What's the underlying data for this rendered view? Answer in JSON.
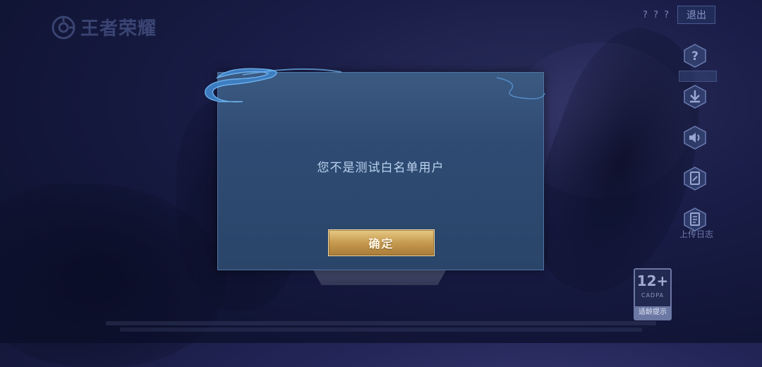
{
  "app": {
    "logo_text": "王者荣耀"
  },
  "topbar": {
    "help_text": "? ? ?",
    "exit_label": "退出"
  },
  "side_buttons": [
    {
      "icon": "question-icon"
    },
    {
      "icon": "download-icon"
    },
    {
      "icon": "speaker-icon"
    },
    {
      "icon": "repair-icon"
    },
    {
      "icon": "log-icon"
    }
  ],
  "upload_log_label": "上传日志",
  "age_rating": {
    "number": "12+",
    "org": "CADPA",
    "tip": "适龄提示"
  },
  "dialog": {
    "message": "您不是测试白名单用户",
    "confirm_label": "确定"
  },
  "colors": {
    "dialog_bg": "#2f4b73",
    "button_gold": "#c69a4f",
    "background": "#1d2150"
  }
}
